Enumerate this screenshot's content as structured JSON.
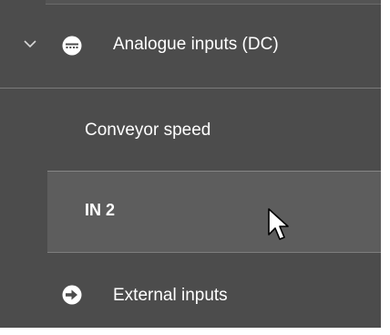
{
  "tree": {
    "group": {
      "label": "Analogue inputs (DC)",
      "icon": "analogue-inputs-icon",
      "expanded": true,
      "items": [
        {
          "label": "Conveyor speed",
          "selected": false
        },
        {
          "label": "IN 2",
          "selected": true
        }
      ]
    },
    "next_group": {
      "label": "External inputs",
      "icon": "external-inputs-icon"
    }
  },
  "colors": {
    "panel_bg": "#4c4c4c",
    "selected_bg": "#5d5d5d",
    "text": "#ffffff",
    "divider": "#7a7a7a"
  }
}
